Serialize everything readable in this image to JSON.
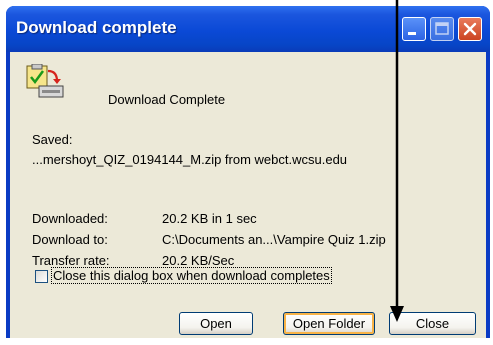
{
  "window": {
    "title": "Download complete"
  },
  "dialog": {
    "heading": "Download Complete",
    "saved_label": "Saved:",
    "saved_value": "...mershoyt_QIZ_0194144_M.zip from webct.wcsu.edu",
    "details": [
      {
        "label": "Downloaded:",
        "value": "20.2 KB in 1 sec"
      },
      {
        "label": "Download to:",
        "value": "C:\\Documents an...\\Vampire Quiz 1.zip"
      },
      {
        "label": "Transfer rate:",
        "value": "20.2 KB/Sec"
      }
    ],
    "checkbox": {
      "label": "Close this dialog box when download completes",
      "checked": false
    }
  },
  "buttons": {
    "open": "Open",
    "open_folder": "Open Folder",
    "close": "Close"
  },
  "colors": {
    "titlebar": "#0a49d6",
    "client_bg": "#ece9d8",
    "close_button": "#cc4422",
    "focus_highlight": "#f8b347"
  }
}
